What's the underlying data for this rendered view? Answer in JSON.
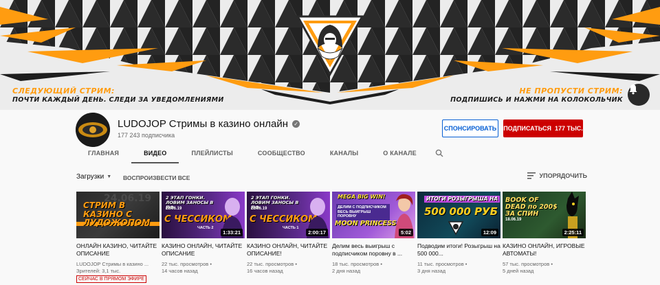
{
  "banner": {
    "left_heading": "СЛЕДУЮЩИЙ СТРИМ:",
    "left_sub": "ПОЧТИ КАЖДЫЙ ДЕНЬ. СЛЕДИ ЗА УВЕДОМЛЕНИЯМИ",
    "right_heading": "НЕ ПРОПУСТИ СТРИМ:",
    "right_sub": "ПОДПИШИСЬ И НАЖМИ НА КОЛОКОЛЬЧИК",
    "colors": {
      "accent": "#ff9c10",
      "dark": "#1c1c1c"
    }
  },
  "channel": {
    "name": "LUDOJOP Стримы в казино онлайн",
    "subscribers": "177 243 подписчика",
    "sponsor_label": "СПОНСИРОВАТЬ",
    "subscribe_label": "ПОДПИСАТЬСЯ",
    "subscribe_count": "177 ТЫС."
  },
  "tabs": [
    {
      "label": "ГЛАВНАЯ"
    },
    {
      "label": "ВИДЕО"
    },
    {
      "label": "ПЛЕЙЛИСТЫ"
    },
    {
      "label": "СООБЩЕСТВО"
    },
    {
      "label": "КАНАЛЫ"
    },
    {
      "label": "О КАНАЛЕ"
    }
  ],
  "toolbar": {
    "uploads": "Загрузки",
    "play_all": "ВОСПРОИЗВЕСТИ ВСЕ",
    "sort": "УПОРЯДОЧИТЬ"
  },
  "videos": [
    {
      "thumb_text": "СТРИМ В КАЗИНО С ЛУДОЖОПОМ",
      "thumb_top": "24.06.19",
      "duration": "",
      "title": "ОНЛАЙН КАЗИНО, ЧИТАЙТЕ ОПИСАНИЕ",
      "meta1": "LUDOJOP Стримы в казино ...",
      "meta2": "Зрителей: 3,1 тыс.",
      "live": "СЕЙЧАС В ПРЯМОМ ЭФИРЕ"
    },
    {
      "thumb_text": "С ЧЕССИКОМ",
      "thumb_top": "2 ЭТАП ГОНКИ. ЛОВИМ ЗАНОСЫ В ПФ",
      "thumb_date": "23.06.19",
      "thumb_part": "ЧАСТЬ 2",
      "duration": "1:33:21",
      "title": "КАЗИНО ОНЛАЙН, ЧИТАЙТЕ ОПИСАНИЕ",
      "meta1": "22 тыс. просмотров •",
      "meta2": "14 часов назад"
    },
    {
      "thumb_text": "С ЧЕССИКОМ",
      "thumb_top": "2 ЭТАП ГОНКИ. ЛОВИМ ЗАНОСЫ В ПФ",
      "thumb_date": "23.06.19",
      "thumb_part": "ЧАСТЬ 1",
      "duration": "2:00:17",
      "title": "КАЗИНО ОНЛАЙН, ЧИТАЙТЕ ОПИСАНИЕ!",
      "meta1": "22 тыс. просмотров •",
      "meta2": "16 часов назад"
    },
    {
      "thumb_text": "MOON PRINCESS",
      "thumb_top": "MEGA BIG WIN!",
      "thumb_mid": "ДЕЛИМ С ПОДПИСЧИКОМ ВЕСЬ ВЫИГРЫШ ПОРОВНУ",
      "duration": "5:02",
      "title": "Делим весь выигрыш с подписчиком поровну в ...",
      "meta1": "18 тыс. просмотров •",
      "meta2": "2 дня назад"
    },
    {
      "thumb_text": "500 000 РУБ",
      "thumb_top": "ИТОГИ РОЗЫГРЫША НА",
      "duration": "12:09",
      "title": "Подводим итоги! Розыгрыш на 500 000...",
      "meta1": "11 тыс. просмотров •",
      "meta2": "3 дня назад"
    },
    {
      "thumb_text": "BOOK OF DEAD по 200$ ЗА СПИН",
      "thumb_date": "18.06.19",
      "duration": "2:25:11",
      "title": "КАЗИНО ОНЛАЙН, ИГРОВЫЕ АВТОМАТЫ!",
      "meta1": "57 тыс. просмотров •",
      "meta2": "5 дней назад"
    }
  ]
}
